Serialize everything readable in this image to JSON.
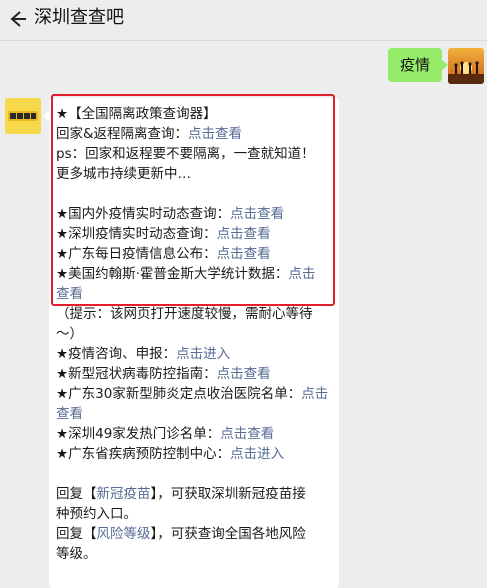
{
  "header": {
    "title": "深圳查查吧"
  },
  "right_message": {
    "text": "疫情"
  },
  "left_message": {
    "l1": "★【全国隔离政策查询器】",
    "l2_text": "回家&返程隔离查询：",
    "l2_link": "点击查看",
    "l3": "ps：回家和返程要不要隔离，一查就知道！",
    "l4": "更多城市持续更新中…",
    "l6_text": "★国内外疫情实时动态查询：",
    "l6_link": "点击查看",
    "l7_text": "★深圳疫情实时动态查询：",
    "l7_link": "点击查看",
    "l8_text": "★广东每日疫情信息公布：",
    "l8_link": "点击查看",
    "l9_text": "★美国约翰斯·霍普金斯大学统计数据：",
    "l9_link_a": "点击",
    "l9_link_b": "查看",
    "l10": "（提示：该网页打开速度较慢，需耐心等待",
    "l11": "～）",
    "l12_text": "★疫情咨询、申报：",
    "l12_link": "点击进入",
    "l13_text": "★新型冠状病毒防控指南：",
    "l13_link": "点击查看",
    "l14_text": "★广东30家新型肺炎定点收治医院名单：",
    "l14_link_a": "点击",
    "l14_link_b": "查看",
    "l15_text": "★深圳49家发热门诊名单：",
    "l15_link": "点击查看",
    "l16_text": "★广东省疾病预防控制中心：",
    "l16_link": "点击进入",
    "r1_pre": "回复【",
    "r1_kw": "新冠疫苗",
    "r1_post": "】，可获取深圳新冠疫苗接",
    "r1_line2": "种预约入口。",
    "r2_pre": "回复【",
    "r2_kw": "风险等级",
    "r2_post": "】，可获查询全国各地风险",
    "r2_line2": "等级。"
  },
  "colors": {
    "link": "#576b95",
    "highlight_box": "#e0202a",
    "bubble_right": "#95ec69"
  },
  "icons": {
    "back": "arrow-left-icon"
  }
}
